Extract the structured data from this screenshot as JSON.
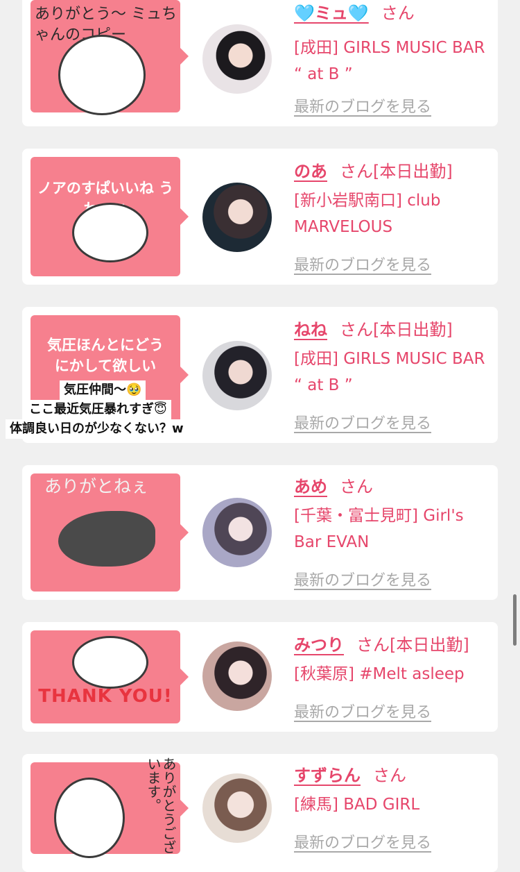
{
  "cards": [
    {
      "sticker_text": "ありがとう〜 ミュちゃんのコピー",
      "name": "🩵ミュ🩵",
      "honorific": "さん",
      "status": "",
      "shop": "[成田] GIRLS MUSIC BAR “ at B ”",
      "blog_link": "最新のブログを見る"
    },
    {
      "sticker_text": "ノアのすぱいいね うわーい",
      "name": "のあ",
      "honorific": "さん",
      "status": "[本日出勤]",
      "shop": "[新小岩駅南口] club MARVELOUS",
      "blog_link": "最新のブログを見る"
    },
    {
      "sticker_text": "気圧ほんとにどう にかして欲しい",
      "name": "ねね",
      "honorific": "さん",
      "status": "[本日出勤]",
      "shop": "[成田] GIRLS MUSIC BAR “ at B ”",
      "blog_link": "最新のブログを見る"
    },
    {
      "sticker_text": "ありがとねぇ",
      "name": "あめ",
      "honorific": "さん",
      "status": "",
      "shop": "[千葉・富士見町] Girl's Bar EVAN",
      "blog_link": "最新のブログを見る"
    },
    {
      "sticker_text": "THANK YOU!",
      "name": "みつり",
      "honorific": "さん",
      "status": "[本日出勤]",
      "shop": "[秋葉原] #Melt asleep",
      "blog_link": "最新のブログを見る"
    },
    {
      "sticker_text": "ありがとうございます。",
      "name": "すずらん",
      "honorific": "さん",
      "status": "",
      "shop": "[練馬] BAD GIRL",
      "blog_link": "最新のブログを見る"
    }
  ],
  "overlay_text": {
    "line1": "気圧仲間〜🥹",
    "line2": "ここ最近気圧暴れすぎ😇",
    "line3": "体調良い日のが少なくない？w"
  },
  "colors": {
    "accent": "#e6466b",
    "bubble": "#f6808e",
    "link_gray": "#a8a8a8",
    "background": "#f0f0f0"
  }
}
